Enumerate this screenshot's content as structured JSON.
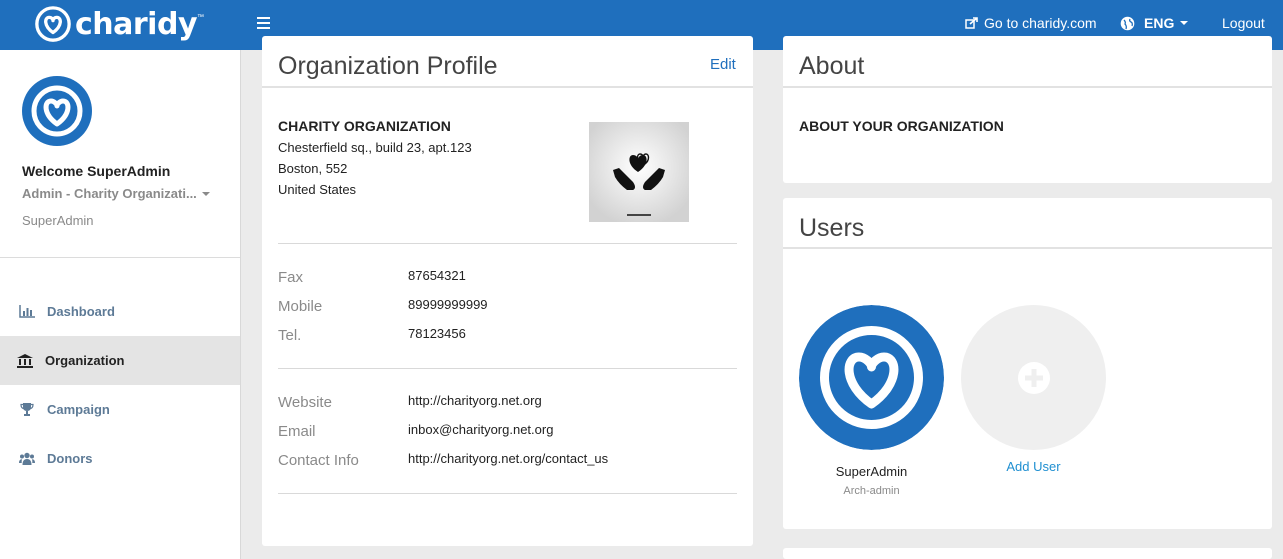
{
  "header": {
    "logo_text": "charidy",
    "logo_tm": "™",
    "goto_label": "Go to charidy.com",
    "lang_label": "ENG",
    "logout_label": "Logout",
    "icons": {
      "menu": "hamburger-icon",
      "external": "external-link-icon",
      "globe": "globe-icon"
    }
  },
  "sidebar": {
    "welcome": "Welcome SuperAdmin",
    "role": "Admin - Charity Organizati...",
    "user": "SuperAdmin",
    "items": [
      {
        "label": "Dashboard",
        "icon": "bar-chart-icon",
        "active": false
      },
      {
        "label": "Organization",
        "icon": "bank-icon",
        "active": true
      },
      {
        "label": "Campaign",
        "icon": "trophy-icon",
        "active": false
      },
      {
        "label": "Donors",
        "icon": "users-icon",
        "active": false
      }
    ]
  },
  "profile": {
    "title": "Organization Profile",
    "edit_label": "Edit",
    "org_name": "CHARITY ORGANIZATION",
    "address_lines": [
      "Chesterfield sq., build 23, apt.123",
      "Boston, 552",
      "United States"
    ],
    "contact_fields": [
      {
        "label": "Fax",
        "value": "87654321"
      },
      {
        "label": "Mobile",
        "value": "89999999999"
      },
      {
        "label": "Tel.",
        "value": "78123456"
      }
    ],
    "web_fields": [
      {
        "label": "Website",
        "value": "http://charityorg.net.org"
      },
      {
        "label": "Email",
        "value": "inbox@charityorg.net.org"
      },
      {
        "label": "Contact Info",
        "value": "http://charityorg.net.org/contact_us"
      }
    ]
  },
  "about": {
    "title": "About",
    "heading": "ABOUT YOUR ORGANIZATION"
  },
  "users": {
    "title": "Users",
    "list": [
      {
        "name": "SuperAdmin",
        "role": "Arch-admin"
      }
    ],
    "add_label": "Add User"
  },
  "colors": {
    "brand": "#1f6fbd",
    "link": "#1f8fd1",
    "active_bg": "#e4e4e4"
  }
}
